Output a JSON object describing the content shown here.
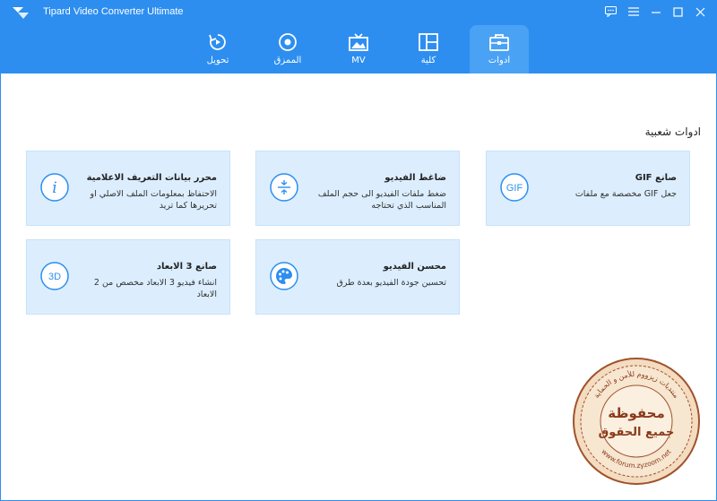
{
  "window": {
    "title": "Tipard Video Converter Ultimate"
  },
  "tabs": [
    {
      "label": "تحويل",
      "icon": "convert-icon"
    },
    {
      "label": "الممزق",
      "icon": "ripper-icon"
    },
    {
      "label": "MV",
      "icon": "mv-icon"
    },
    {
      "label": "كلية",
      "icon": "collage-icon"
    },
    {
      "label": "ادوات",
      "icon": "toolbox-icon",
      "active": true
    }
  ],
  "section": {
    "title": "ادوات شعبية"
  },
  "cards": [
    {
      "title": "صانع GIF",
      "desc": "جعل GIF مخصصة مع ملفات",
      "icon": "gif-icon",
      "icon_text": "GIF"
    },
    {
      "title": "ضاغط الفيديو",
      "desc": "ضغط ملفات الفيديو الى حجم الملف المناسب الذي تحتاجه",
      "icon": "compress-icon"
    },
    {
      "title": "محرر بيانات التعريف الاعلامية",
      "desc": "الاحتفاظ بمعلومات الملف الاصلي او تحريرها كما تريد",
      "icon": "info-icon",
      "icon_text": "i"
    },
    {
      "title": "محسن الفيديو",
      "desc": "تحسين جودة الفيديو بعدة طرق",
      "icon": "palette-icon"
    },
    {
      "title": "صانع 3 الابعاد",
      "desc": "انشاء فيديو 3 الابعاد مخصص من 2 الابعاد",
      "icon": "3d-icon",
      "icon_text": "3D"
    }
  ],
  "watermark": {
    "text_top": "منتديات زيزووم للأمن و الحماية",
    "text_center_1": "محفوظة",
    "text_center_2": "جميع الحقوق",
    "text_bottom": "www.forum.zyzoom.net"
  },
  "colors": {
    "header": "#2d8ef0",
    "active_tab": "#4aa2f5",
    "card_bg": "#dceefe",
    "icon_blue": "#2d8ef0"
  }
}
